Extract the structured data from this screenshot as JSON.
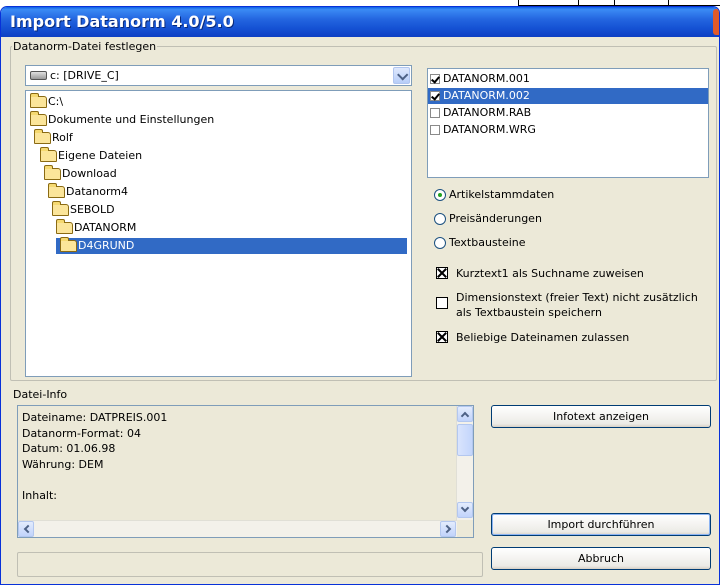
{
  "window": {
    "title": "Import Datanorm 4.0/5.0"
  },
  "file_group": {
    "legend": "Datanorm-Datei festlegen",
    "drive": "c: [DRIVE_C]",
    "directories": [
      {
        "label": "C:\\",
        "open": true
      },
      {
        "label": "Dokumente und Einstellungen",
        "open": true
      },
      {
        "label": "Rolf",
        "open": true
      },
      {
        "label": "Eigene Dateien",
        "open": true
      },
      {
        "label": "Download",
        "open": true
      },
      {
        "label": "Datanorm4",
        "open": true
      },
      {
        "label": "SEBOLD",
        "open": true
      },
      {
        "label": "DATANORM",
        "open": true
      },
      {
        "label": "D4GRUND",
        "open": true,
        "selected": true
      }
    ],
    "files": [
      {
        "label": "DATANORM.001",
        "checked": true,
        "selected": false
      },
      {
        "label": "DATANORM.002",
        "checked": true,
        "selected": true
      },
      {
        "label": "DATANORM.RAB",
        "checked": false,
        "selected": false
      },
      {
        "label": "DATANORM.WRG",
        "checked": false,
        "selected": false
      }
    ]
  },
  "import_type": {
    "options": [
      {
        "label": "Artikelstammdaten",
        "checked": true
      },
      {
        "label": "Preisänderungen",
        "checked": false
      },
      {
        "label": "Textbausteine",
        "checked": false
      }
    ]
  },
  "options": [
    {
      "label": "Kurztext1 als Suchname zuweisen",
      "checked": true
    },
    {
      "label": "Dimensionstext (freier Text) nicht zusätzlich\nals Textbaustein speichern",
      "checked": false
    },
    {
      "label": "Beliebige Dateinamen zulassen",
      "checked": true
    }
  ],
  "info_group": {
    "legend": "Datei-Info",
    "text": "Dateiname: DATPREIS.001\nDatanorm-Format: 04\nDatum: 01.06.98\nWährung: DEM\n\nInhalt:"
  },
  "buttons": {
    "infotext": "Infotext anzeigen",
    "import": "Import durchführen",
    "cancel": "Abbruch"
  }
}
